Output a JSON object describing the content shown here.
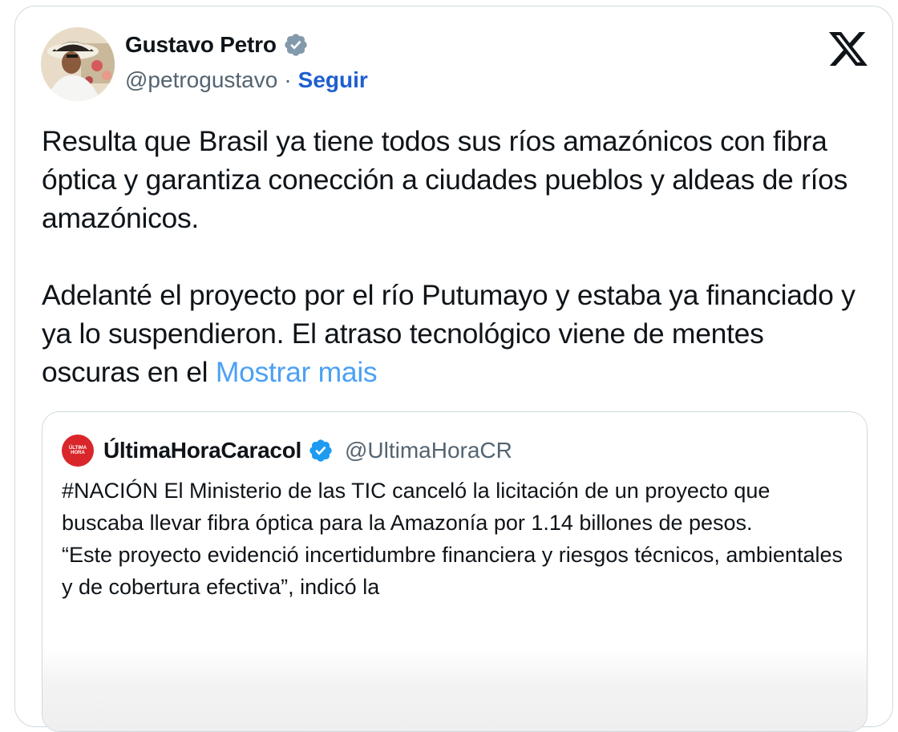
{
  "author": {
    "name": "Gustavo Petro",
    "handle": "@petrogustavo",
    "separator": "·",
    "follow_label": "Seguir",
    "verified_icon": "verified-badge-gray-icon"
  },
  "platform_logo": "x-logo-icon",
  "tweet": {
    "paragraphs": [
      "Resulta que Brasil ya tiene todos sus ríos amazónicos con fibra óptica y garantiza conección a ciudades pueblos y aldeas de ríos amazónicos.",
      "Adelanté el proyecto por el río Putumayo y estaba ya financiado y ya lo suspendieron. El atraso tecnológico viene de mentes oscuras en el"
    ],
    "show_more_label": "Mostrar mais"
  },
  "quote": {
    "avatar_text_top": "ÚLTIMA",
    "avatar_text_bottom": "HORA",
    "name": "ÚltimaHoraCaracol",
    "handle": "@UltimaHoraCR",
    "verified_icon": "verified-badge-blue-icon",
    "paragraphs": [
      "#NACIÓN El Ministerio de las TIC canceló la licitación de un proyecto que buscaba llevar fibra óptica para la Amazonía  por 1.14 billones de pesos.",
      "“Este proyecto evidenció incertidumbre financiera y riesgos técnicos, ambientales y de cobertura efectiva”, indicó la"
    ]
  },
  "colors": {
    "text": "#0f1419",
    "secondary": "#536471",
    "link": "#4ca0f5",
    "follow": "#1d5fcf",
    "border": "#cfd9de",
    "verified_blue": "#1d9bf0",
    "verified_gray": "#829aab",
    "brand_red": "#d9262a"
  }
}
